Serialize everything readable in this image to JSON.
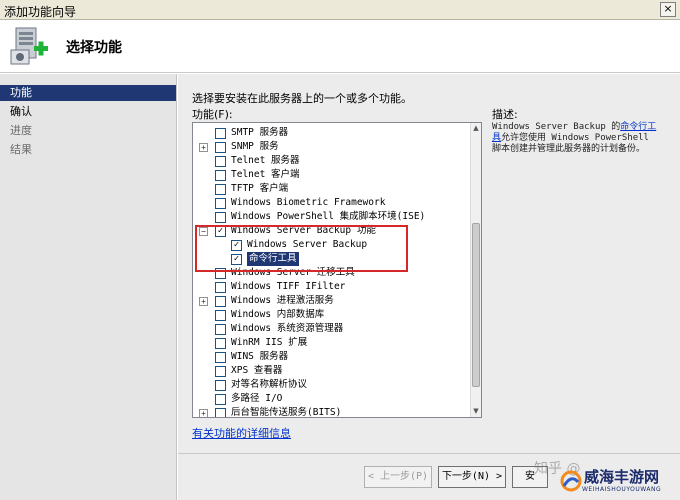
{
  "window": {
    "title": "添加功能向导",
    "close_glyph": "×"
  },
  "header": {
    "title": "选择功能"
  },
  "sidebar": {
    "items": [
      {
        "label": "功能",
        "state": "active"
      },
      {
        "label": "确认",
        "state": "normal"
      },
      {
        "label": "进度",
        "state": "disabled"
      },
      {
        "label": "结果",
        "state": "disabled"
      }
    ]
  },
  "main": {
    "intro": "选择要安装在此服务器上的一个或多个功能。",
    "list_label": "功能(F):",
    "description_label": "描述:",
    "description_prefix": "Windows Server Backup 的",
    "description_link": "命令行工具",
    "description_suffix": "允许您使用 Windows PowerShell 脚本创建并管理此服务器的计划备份。",
    "more_info_link": "有关功能的详细信息"
  },
  "features": [
    {
      "label": "SMTP 服务器",
      "checked": false,
      "expander": "",
      "indent": 0
    },
    {
      "label": "SNMP 服务",
      "checked": false,
      "expander": "+",
      "indent": 0
    },
    {
      "label": "Telnet 服务器",
      "checked": false,
      "expander": "",
      "indent": 0
    },
    {
      "label": "Telnet 客户端",
      "checked": false,
      "expander": "",
      "indent": 0
    },
    {
      "label": "TFTP 客户端",
      "checked": false,
      "expander": "",
      "indent": 0
    },
    {
      "label": "Windows Biometric Framework",
      "checked": false,
      "expander": "",
      "indent": 0
    },
    {
      "label": "Windows PowerShell 集成脚本环境(ISE)",
      "checked": false,
      "expander": "",
      "indent": 0
    },
    {
      "label": "Windows Server Backup 功能",
      "checked": true,
      "expander": "−",
      "indent": 0
    },
    {
      "label": "Windows Server Backup",
      "checked": true,
      "expander": "",
      "indent": 1
    },
    {
      "label": "命令行工具",
      "checked": true,
      "expander": "",
      "indent": 1,
      "selected": true
    },
    {
      "label": "Windows Server 迁移工具",
      "checked": false,
      "expander": "",
      "indent": 0
    },
    {
      "label": "Windows TIFF IFilter",
      "checked": false,
      "expander": "",
      "indent": 0
    },
    {
      "label": "Windows 进程激活服务",
      "checked": false,
      "expander": "+",
      "indent": 0
    },
    {
      "label": "Windows 内部数据库",
      "checked": false,
      "expander": "",
      "indent": 0
    },
    {
      "label": "Windows 系统资源管理器",
      "checked": false,
      "expander": "",
      "indent": 0
    },
    {
      "label": "WinRM IIS 扩展",
      "checked": false,
      "expander": "",
      "indent": 0
    },
    {
      "label": "WINS 服务器",
      "checked": false,
      "expander": "",
      "indent": 0
    },
    {
      "label": "XPS 查看器",
      "checked": false,
      "expander": "",
      "indent": 0
    },
    {
      "label": "对等名称解析协议",
      "checked": false,
      "expander": "",
      "indent": 0
    },
    {
      "label": "多路径 I/O",
      "checked": false,
      "expander": "",
      "indent": 0
    },
    {
      "label": "后台智能传送服务(BITS)",
      "checked": false,
      "expander": "+",
      "indent": 0
    }
  ],
  "buttons": {
    "back": "< 上一步(P)",
    "next": "下一步(N) >",
    "install": "安"
  },
  "watermark": {
    "text": "知乎 @",
    "logo_text": "威海丰游网",
    "logo_sub": "WEIHAISHOUYOUWANG"
  },
  "colors": {
    "selection": "#1f3873",
    "highlight_box": "#d62828",
    "link": "#0033cc"
  }
}
